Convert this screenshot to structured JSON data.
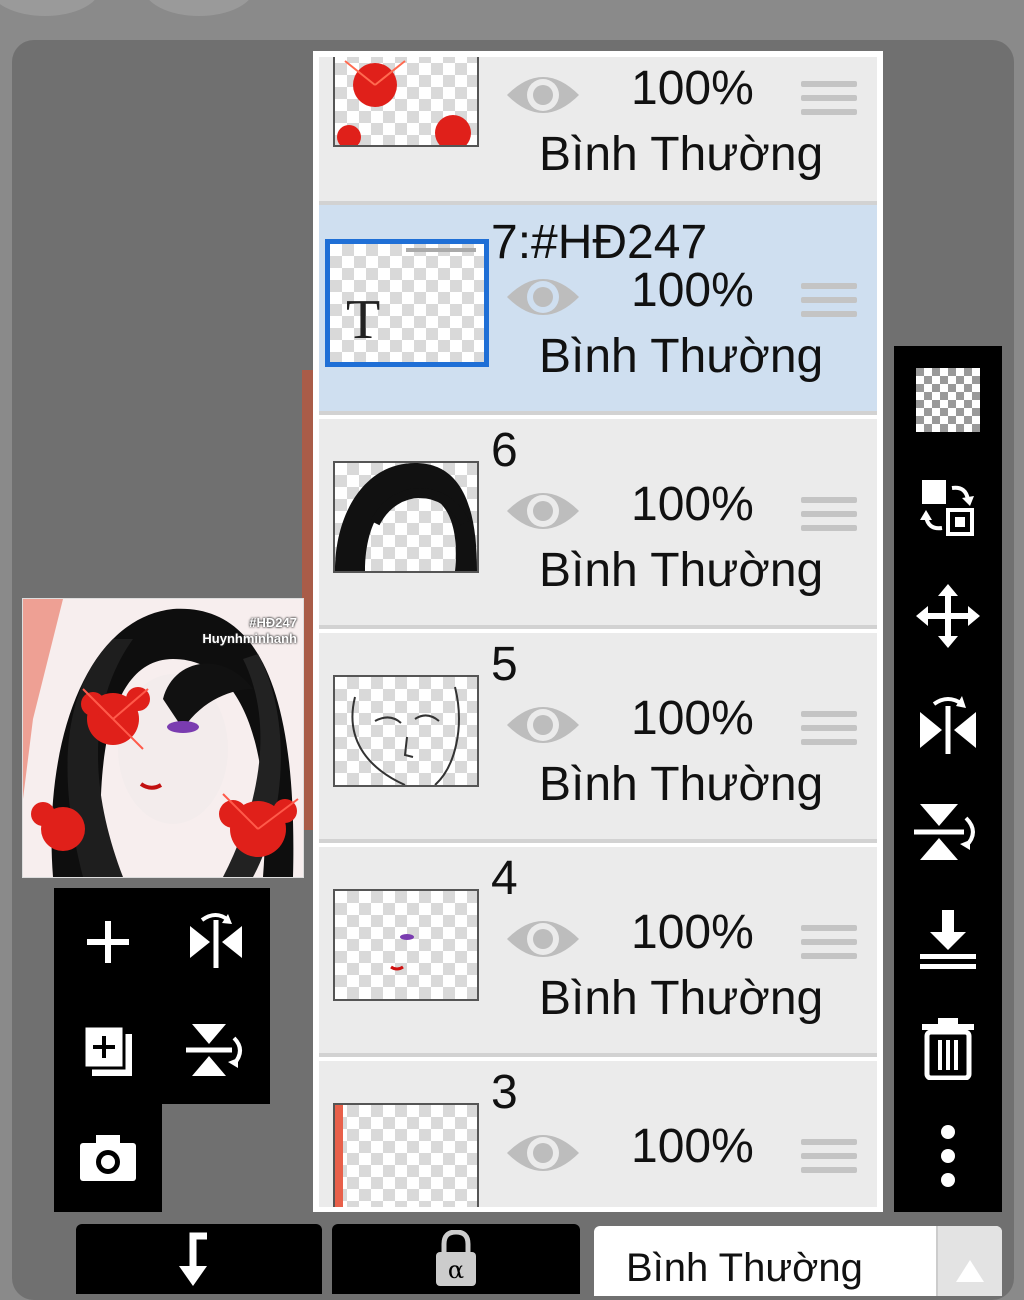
{
  "layers": [
    {
      "name": "",
      "opacity": "100%",
      "blend": "Bình Thường",
      "selected": false
    },
    {
      "name": "7:#HĐ247",
      "opacity": "100%",
      "blend": "Bình Thường",
      "selected": true,
      "thumb_letter": "T"
    },
    {
      "name": "6",
      "opacity": "100%",
      "blend": "Bình Thường",
      "selected": false
    },
    {
      "name": "5",
      "opacity": "100%",
      "blend": "Bình Thường",
      "selected": false
    },
    {
      "name": "4",
      "opacity": "100%",
      "blend": "Bình Thường",
      "selected": false
    },
    {
      "name": "3",
      "opacity": "100%",
      "blend": "",
      "selected": false
    }
  ],
  "preview": {
    "line1": "#HĐ247",
    "line2": "Huynhminhanh"
  },
  "bottom": {
    "blend_mode": "Bình Thường"
  },
  "colors": {
    "selected_bg": "#cfdff0",
    "selected_border": "#1f6fd6",
    "accent_red": "#e0201a"
  },
  "icons": {
    "left": [
      "add-layer-icon",
      "flip-horizontal-icon",
      "add-copy-layer-icon",
      "flip-vertical-icon",
      "camera-icon"
    ],
    "right": [
      "transparency-icon",
      "swap-layer-icon",
      "move-icon",
      "flip-horizontal-icon",
      "flip-vertical-icon",
      "merge-down-icon",
      "trash-icon",
      "more-options-icon"
    ],
    "bottom": [
      "back-arrow-icon",
      "alpha-lock-icon",
      "dropdown-arrow-icon"
    ]
  }
}
